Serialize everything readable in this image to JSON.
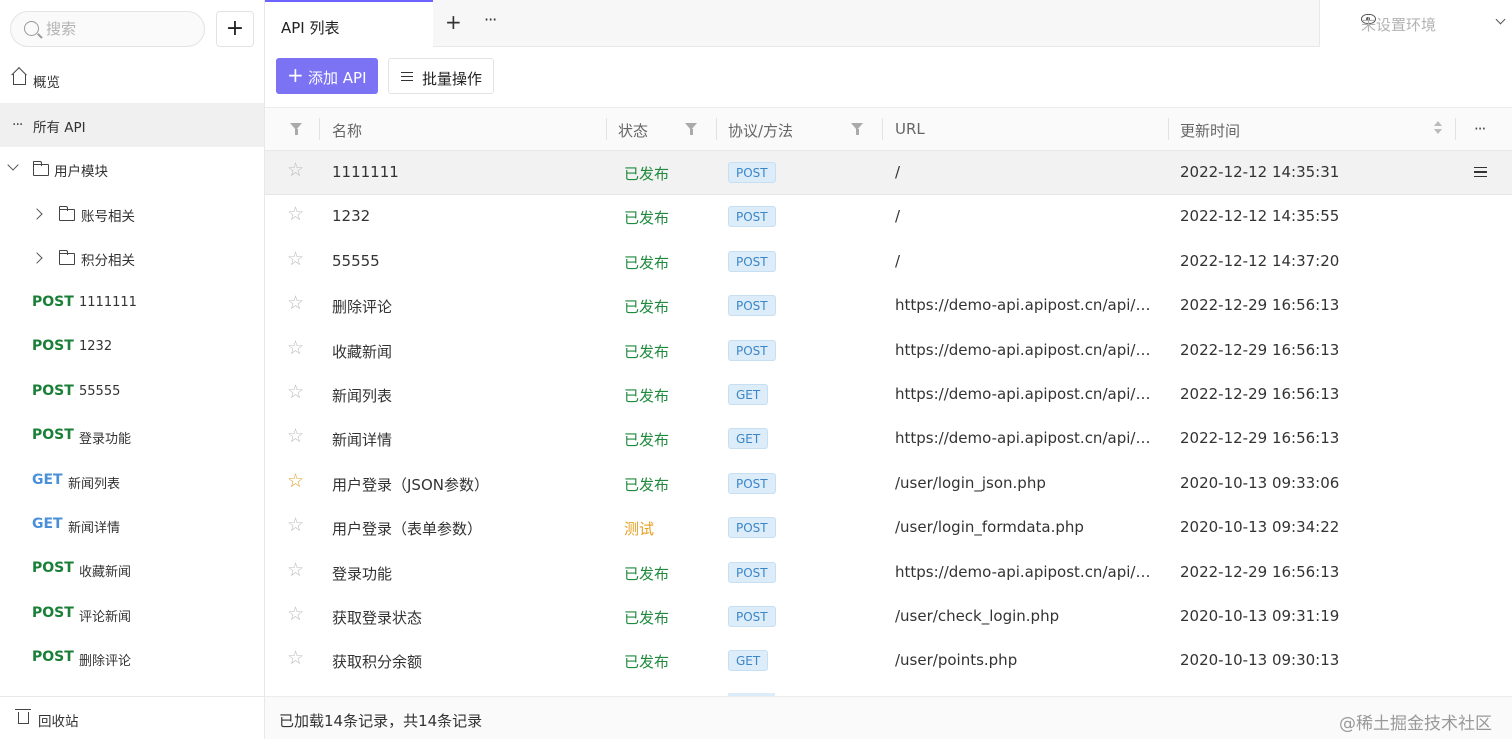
{
  "sidebar": {
    "search_placeholder": "搜索",
    "add_label": "+",
    "overview": "概览",
    "all_api": "所有 API",
    "module": "用户模块",
    "folders": [
      "账号相关",
      "积分相关"
    ],
    "apis": [
      {
        "method": "POST",
        "name": "1111111"
      },
      {
        "method": "POST",
        "name": "1232"
      },
      {
        "method": "POST",
        "name": "55555"
      },
      {
        "method": "POST",
        "name": "登录功能"
      },
      {
        "method": "GET",
        "name": "新闻列表"
      },
      {
        "method": "GET",
        "name": "新闻详情"
      },
      {
        "method": "POST",
        "name": "收藏新闻"
      },
      {
        "method": "POST",
        "name": "评论新闻"
      },
      {
        "method": "POST",
        "name": "删除评论"
      }
    ],
    "trash": "回收站"
  },
  "tabs": {
    "active": "API 列表",
    "plus": "+",
    "more": "···"
  },
  "env": {
    "placeholder": "未设置环境"
  },
  "toolbar": {
    "add_api": "添加 API",
    "batch": "批量操作"
  },
  "table": {
    "headers": {
      "name": "名称",
      "status": "状态",
      "method": "协议/方法",
      "url": "URL",
      "updated": "更新时间",
      "more": "···"
    },
    "rows": [
      {
        "name": "1111111",
        "status": "已发布",
        "method": "POST",
        "url": "/",
        "time": "2022-12-12 14:35:31",
        "fav": false
      },
      {
        "name": "1232",
        "status": "已发布",
        "method": "POST",
        "url": "/",
        "time": "2022-12-12 14:35:55",
        "fav": false
      },
      {
        "name": "55555",
        "status": "已发布",
        "method": "POST",
        "url": "/",
        "time": "2022-12-12 14:37:20",
        "fav": false
      },
      {
        "name": "删除评论",
        "status": "已发布",
        "method": "POST",
        "url": "https://demo-api.apipost.cn/api/de...",
        "time": "2022-12-29 16:56:13",
        "fav": false
      },
      {
        "name": "收藏新闻",
        "status": "已发布",
        "method": "POST",
        "url": "https://demo-api.apipost.cn/api/de...",
        "time": "2022-12-29 16:56:13",
        "fav": false
      },
      {
        "name": "新闻列表",
        "status": "已发布",
        "method": "GET",
        "url": "https://demo-api.apipost.cn/api/de...",
        "time": "2022-12-29 16:56:13",
        "fav": false
      },
      {
        "name": "新闻详情",
        "status": "已发布",
        "method": "GET",
        "url": "https://demo-api.apipost.cn/api/de...",
        "time": "2022-12-29 16:56:13",
        "fav": false
      },
      {
        "name": "用户登录（JSON参数）",
        "status": "已发布",
        "method": "POST",
        "url": "/user/login_json.php",
        "time": "2020-10-13 09:33:06",
        "fav": true
      },
      {
        "name": "用户登录（表单参数）",
        "status": "测试",
        "method": "POST",
        "url": "/user/login_formdata.php",
        "time": "2020-10-13 09:34:22",
        "fav": false
      },
      {
        "name": "登录功能",
        "status": "已发布",
        "method": "POST",
        "url": "https://demo-api.apipost.cn/api/de...",
        "time": "2022-12-29 16:56:13",
        "fav": false
      },
      {
        "name": "获取登录状态",
        "status": "已发布",
        "method": "POST",
        "url": "/user/check_login.php",
        "time": "2020-10-13 09:31:19",
        "fav": false
      },
      {
        "name": "获取积分余额",
        "status": "已发布",
        "method": "GET",
        "url": "/user/points.php",
        "time": "2020-10-13 09:30:13",
        "fav": false
      }
    ]
  },
  "footer": {
    "count": "已加载14条记录，共14条记录",
    "watermark": "@稀土掘金技术社区"
  },
  "colors": {
    "accent": "#7b73f4",
    "post": "#1a7f37",
    "get": "#4a90d9",
    "published": "#1f8a3e",
    "testing": "#e6a020",
    "favorite": "#e0a030"
  },
  "icons": [
    "search-icon",
    "home-icon",
    "more-icon",
    "chevron-down-icon",
    "chevron-right-icon",
    "folder-icon",
    "trash-icon",
    "eye-icon",
    "plus-icon",
    "batch-icon",
    "filter-icon",
    "sort-icon",
    "star-icon",
    "menu-icon"
  ]
}
